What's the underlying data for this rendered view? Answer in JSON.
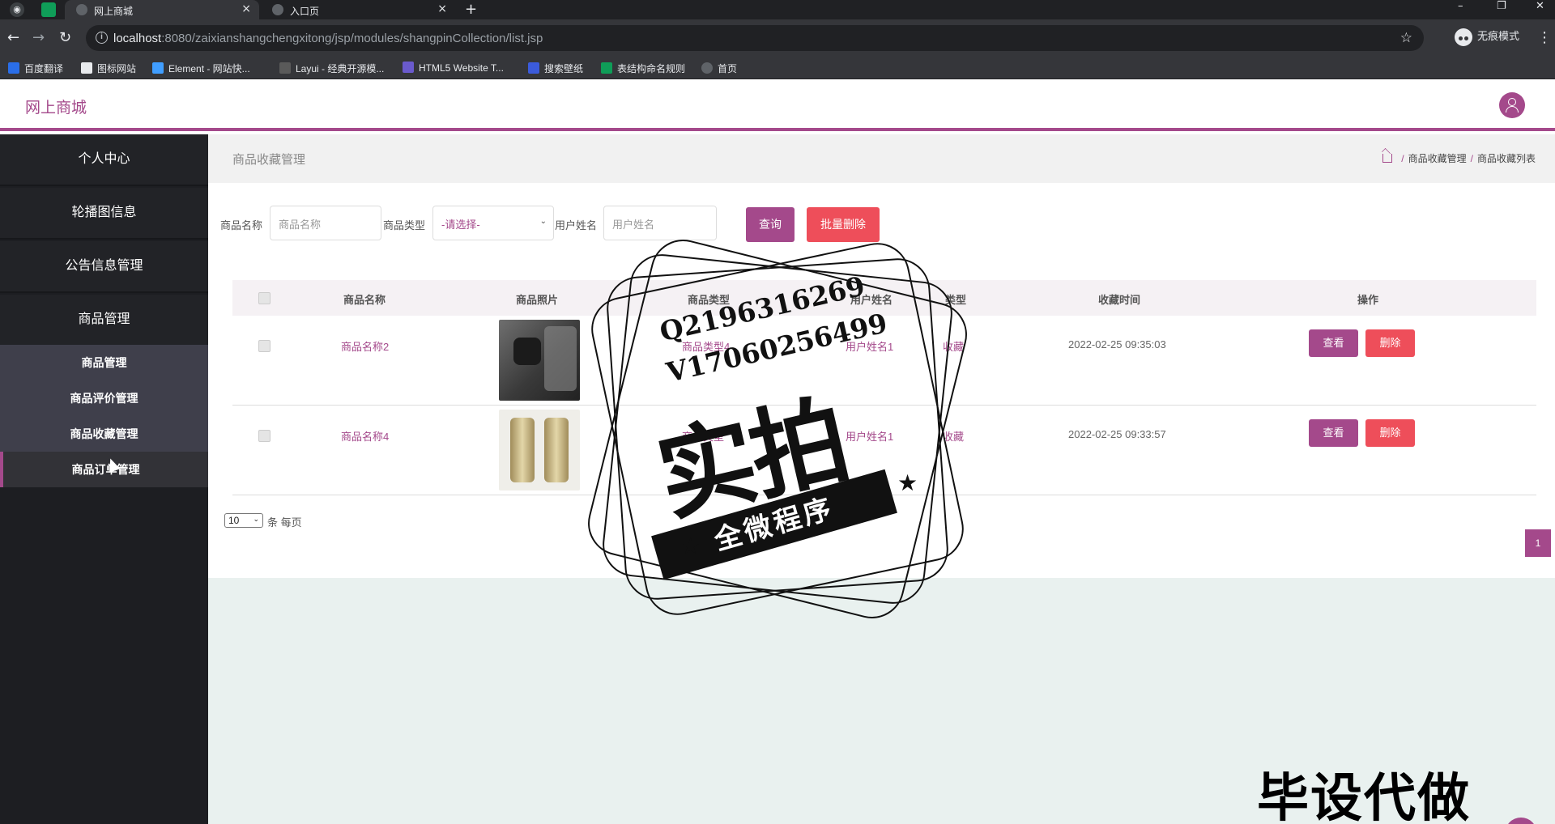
{
  "browser": {
    "tabs": [
      {
        "title": "网上商城",
        "close": "×"
      },
      {
        "title": "入口页",
        "close": "×"
      }
    ],
    "new_tab": "+",
    "window_controls": {
      "minimize": "–",
      "restore": "❐",
      "close": "✕"
    },
    "nav": {
      "back": "←",
      "forward": "→",
      "reload": "↻"
    },
    "url_host": "localhost",
    "url_rest": ":8080/zaixianshangchengxitong/jsp/modules/shangpinCollection/list.jsp",
    "info_glyph": "i",
    "star_glyph": "☆",
    "incognito_label": "无痕模式",
    "menu_glyph": "⋮",
    "bookmarks": [
      "百度翻译",
      "图标网站",
      "Element - 网站快...",
      "Layui - 经典开源模...",
      "HTML5 Website T...",
      "搜索壁纸",
      "表结构命名规则",
      "首页"
    ]
  },
  "app": {
    "brand": "网上商城",
    "sidebar": {
      "items": [
        "个人中心",
        "轮播图信息",
        "公告信息管理",
        "商品管理"
      ],
      "subitems": [
        "商品管理",
        "商品评价管理",
        "商品收藏管理",
        "商品订单管理"
      ],
      "active_subitem": "商品收藏管理"
    },
    "page_title": "商品收藏管理",
    "breadcrumb": [
      "商品收藏管理",
      "商品收藏列表"
    ],
    "breadcrumb_sep": "/",
    "filters": {
      "name_label": "商品名称",
      "name_placeholder": "商品名称",
      "type_label": "商品类型",
      "type_selected": "-请选择-",
      "user_label": "用户姓名",
      "user_placeholder": "用户姓名",
      "query_button": "查询",
      "batch_delete_button": "批量删除"
    },
    "table": {
      "headers": [
        "商品名称",
        "商品照片",
        "商品类型",
        "用户姓名",
        "类型",
        "收藏时间",
        "操作"
      ],
      "rows": [
        {
          "name": "商品名称2",
          "type": "商品类型4",
          "user": "用户姓名1",
          "kind": "收藏",
          "time": "2022-02-25 09:35:03"
        },
        {
          "name": "商品名称4",
          "type": "商品类型",
          "user": "用户姓名1",
          "kind": "收藏",
          "time": "2022-02-25 09:33:57"
        }
      ],
      "view_button": "查看",
      "delete_button": "删除"
    },
    "pagination": {
      "page_size": "10",
      "page_size_label": "条 每页",
      "current_page": "1"
    },
    "colors": {
      "accent": "#a4498b",
      "danger": "#ee4e5a",
      "sidebar": "#1d1e22"
    }
  },
  "watermark": {
    "line_qq": "Q2196316269",
    "line_v": "V17060256499",
    "big": "实拍",
    "ribbon": "全微程序",
    "star": "★",
    "bottom": "毕设代做"
  }
}
